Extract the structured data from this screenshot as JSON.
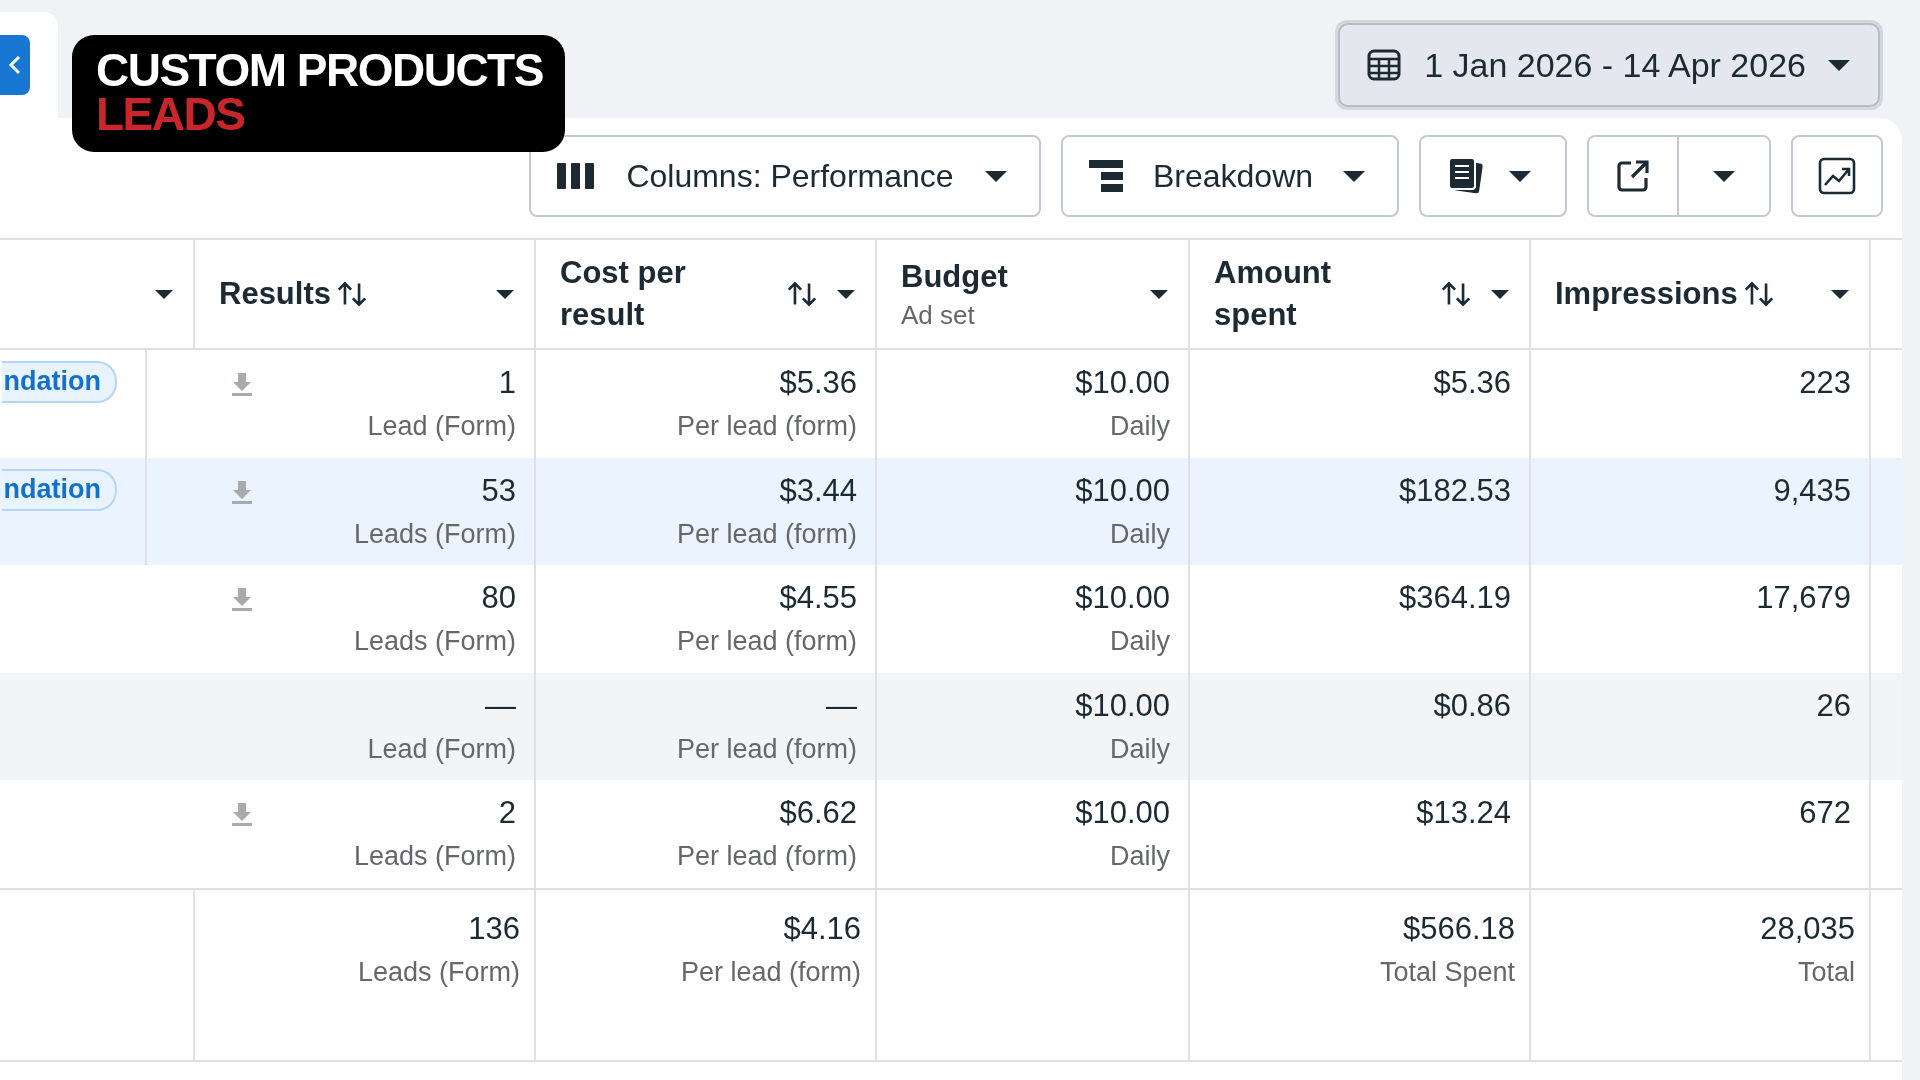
{
  "overlay": {
    "line_1": "CUSTOM PRODUCTS",
    "line_2": "LEADS"
  },
  "date_range": {
    "label": "1 Jan 2026 - 14 Apr 2026"
  },
  "toolbar": {
    "columns": "Columns: Performance",
    "breakdown": "Breakdown"
  },
  "table": {
    "columns": [
      {
        "kind": "blank"
      },
      {
        "kind": "sort",
        "label": "Results"
      },
      {
        "kind": "sort-wrap",
        "label": "Cost per result"
      },
      {
        "kind": "sub",
        "label": "Budget",
        "sub": "Ad set"
      },
      {
        "kind": "sort-wrap",
        "label": "Amount spent"
      },
      {
        "kind": "sort",
        "label": "Impressions"
      }
    ],
    "rows": [
      {
        "tag": "ndation",
        "download": true,
        "selected": false,
        "hovered": false,
        "results": "1",
        "results_unit": "Lead (Form)",
        "cost": "$5.36",
        "cost_unit": "Per lead (form)",
        "budget": "$10.00",
        "budget_unit": "Daily",
        "amount": "$5.36",
        "impressions": "223"
      },
      {
        "tag": "ndation",
        "download": true,
        "selected": true,
        "hovered": false,
        "results": "53",
        "results_unit": "Leads (Form)",
        "cost": "$3.44",
        "cost_unit": "Per lead (form)",
        "budget": "$10.00",
        "budget_unit": "Daily",
        "amount": "$182.53",
        "impressions": "9,435"
      },
      {
        "download": true,
        "selected": false,
        "hovered": false,
        "results": "80",
        "results_unit": "Leads (Form)",
        "cost": "$4.55",
        "cost_unit": "Per lead (form)",
        "budget": "$10.00",
        "budget_unit": "Daily",
        "amount": "$364.19",
        "impressions": "17,679"
      },
      {
        "download": false,
        "selected": false,
        "hovered": true,
        "results": "—",
        "results_unit": "Lead (Form)",
        "cost": "—",
        "cost_unit": "Per lead (form)",
        "budget": "$10.00",
        "budget_unit": "Daily",
        "amount": "$0.86",
        "impressions": "26"
      },
      {
        "download": true,
        "selected": false,
        "hovered": false,
        "results": "2",
        "results_unit": "Leads (Form)",
        "cost": "$6.62",
        "cost_unit": "Per lead (form)",
        "budget": "$10.00",
        "budget_unit": "Daily",
        "amount": "$13.24",
        "impressions": "672"
      }
    ],
    "totals": {
      "results": "136",
      "results_unit": "Leads (Form)",
      "cost": "$4.16",
      "cost_unit": "Per lead (form)",
      "amount": "$566.18",
      "amount_unit": "Total Spent",
      "impressions": "28,035",
      "impressions_unit": "Total"
    }
  }
}
